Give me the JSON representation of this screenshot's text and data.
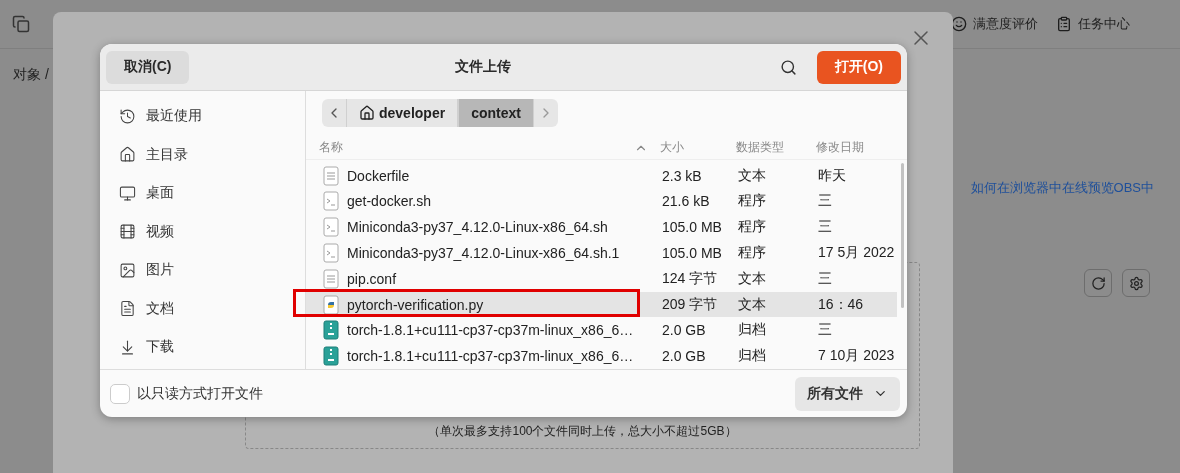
{
  "page": {
    "breadcrumb": "对象 /",
    "header_links": [
      {
        "label": "满意度评价",
        "kind": "smiley"
      },
      {
        "label": "任务中心",
        "kind": "clipboard"
      }
    ],
    "help_link": "如何在浏览器中在线预览OBS中",
    "upload_hint": "（单次最多支持100个文件同时上传，总大小不超过5GB）"
  },
  "dialog": {
    "title": "文件上传",
    "cancel": "取消(C)",
    "open": "打开(O)",
    "sidebar": [
      {
        "label": "最近使用",
        "kind": "recent",
        "selected": false
      },
      {
        "label": "主目录",
        "kind": "home",
        "selected": false
      },
      {
        "label": "桌面",
        "kind": "desktop",
        "selected": false
      },
      {
        "label": "视频",
        "kind": "video",
        "selected": false
      },
      {
        "label": "图片",
        "kind": "picture",
        "selected": false
      },
      {
        "label": "文档",
        "kind": "document",
        "selected": false
      },
      {
        "label": "下载",
        "kind": "download",
        "selected": false
      }
    ],
    "path": [
      {
        "label": "developer",
        "kind": "home",
        "selected": false
      },
      {
        "label": "context",
        "kind": "folder",
        "selected": true
      }
    ],
    "columns": [
      {
        "label": "名称",
        "sorted": true
      },
      {
        "label": "大小",
        "sorted": false
      },
      {
        "label": "数据类型",
        "sorted": false
      },
      {
        "label": "修改日期",
        "sorted": false
      }
    ],
    "files": [
      {
        "name": "Dockerfile",
        "size": "2.3 kB",
        "type": "文本",
        "date": "昨天",
        "kind": "text",
        "selected": false,
        "highlighted": false
      },
      {
        "name": "get-docker.sh",
        "size": "21.6 kB",
        "type": "程序",
        "date": "三",
        "kind": "script",
        "selected": false,
        "highlighted": false
      },
      {
        "name": "Miniconda3-py37_4.12.0-Linux-x86_64.sh",
        "size": "105.0 MB",
        "type": "程序",
        "date": "三",
        "kind": "script",
        "selected": false,
        "highlighted": false
      },
      {
        "name": "Miniconda3-py37_4.12.0-Linux-x86_64.sh.1",
        "size": "105.0 MB",
        "type": "程序",
        "date": "17 5月 2022",
        "kind": "script",
        "selected": false,
        "highlighted": false
      },
      {
        "name": "pip.conf",
        "size": "124 字节",
        "type": "文本",
        "date": "三",
        "kind": "text",
        "selected": false,
        "highlighted": false
      },
      {
        "name": "pytorch-verification.py",
        "size": "209 字节",
        "type": "文本",
        "date": "16：46",
        "kind": "python",
        "selected": true,
        "highlighted": true
      },
      {
        "name": "torch-1.8.1+cu111-cp37-cp37m-linux_x86_6…",
        "size": "2.0 GB",
        "type": "归档",
        "date": "三",
        "kind": "archive",
        "selected": false,
        "highlighted": false
      },
      {
        "name": "torch-1.8.1+cu111-cp37-cp37m-linux_x86_6…",
        "size": "2.0 GB",
        "type": "归档",
        "date": "7 10月 2023",
        "kind": "archive",
        "selected": false,
        "highlighted": false
      }
    ],
    "readonly": {
      "label": "以只读方式打开文件",
      "checked": false
    },
    "filter": "所有文件"
  }
}
